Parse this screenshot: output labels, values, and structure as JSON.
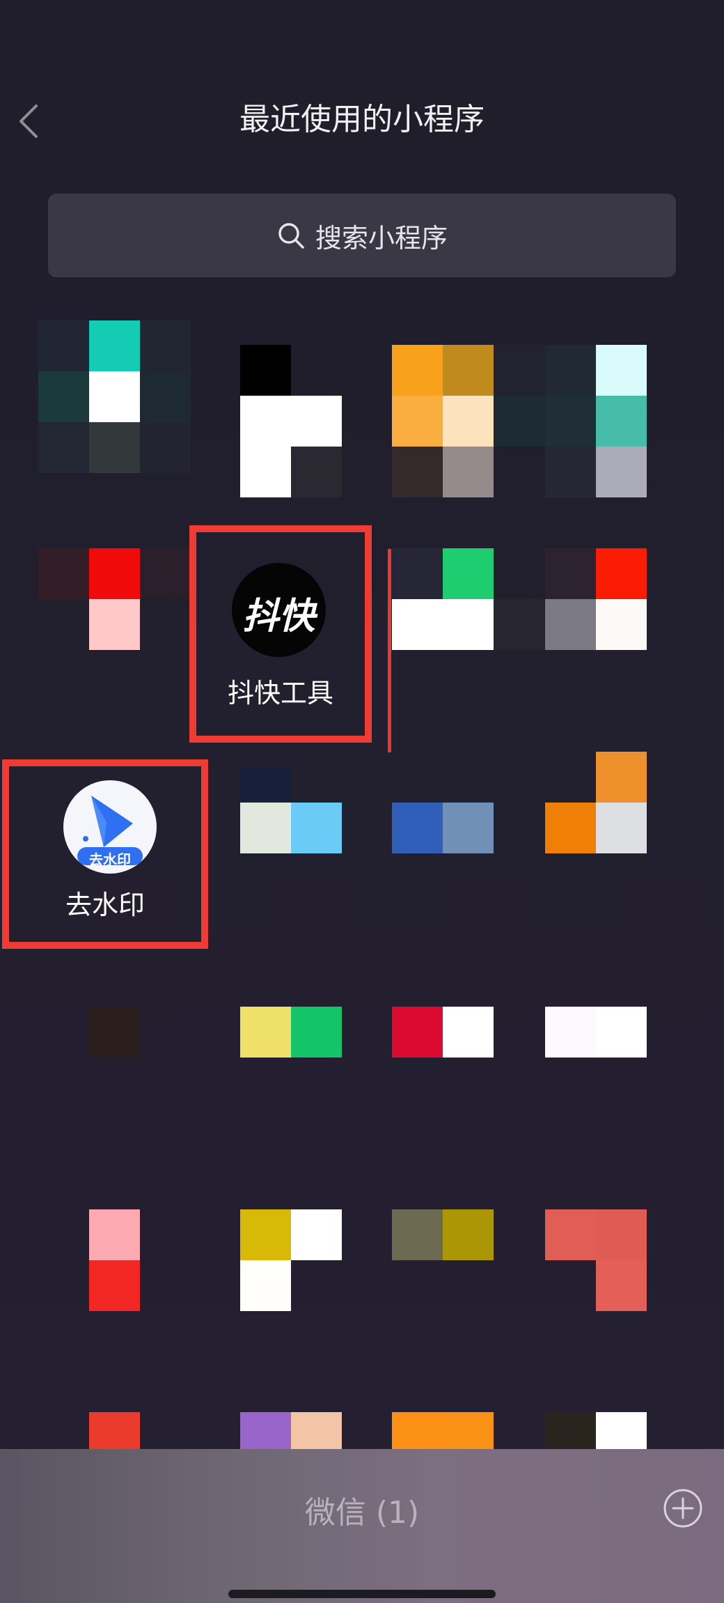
{
  "header": {
    "title": "最近使用的小程序"
  },
  "search": {
    "placeholder": "搜索小程序"
  },
  "apps": {
    "doukuai": {
      "label": "抖快工具",
      "icon_text": "抖快"
    },
    "qushuiyin": {
      "label": "去水印",
      "icon_text": "去水印"
    }
  },
  "bottom": {
    "label": "微信 (1)"
  },
  "colors": {
    "highlight_border": "#ee3b33",
    "background": "#221f2e",
    "search_bg": "#393844"
  }
}
